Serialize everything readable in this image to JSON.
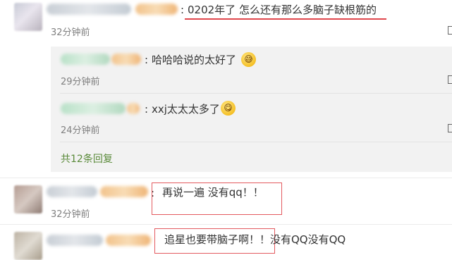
{
  "comments": [
    {
      "text": "0202年了 怎么还有那么多脑子缺根筋的",
      "time": "32分钟前"
    },
    {
      "text": "再说一遍 没有qq！！",
      "time": "32分钟前"
    },
    {
      "text": "追星也要带脑子啊！！没有QQ没有QQ"
    }
  ],
  "replies": [
    {
      "text": "哈哈哈说的太好了",
      "time": "29分钟前",
      "emoji": "grinning-sweat-emoji"
    },
    {
      "text": "xxj太太太多了",
      "time": "24分钟前",
      "emoji": "drooling-emoji"
    }
  ],
  "reply_summary": "共12条回复",
  "colors": {
    "highlight": "#e0464c",
    "link": "#5a8a3a",
    "reply_background": "#f2f2f2"
  }
}
